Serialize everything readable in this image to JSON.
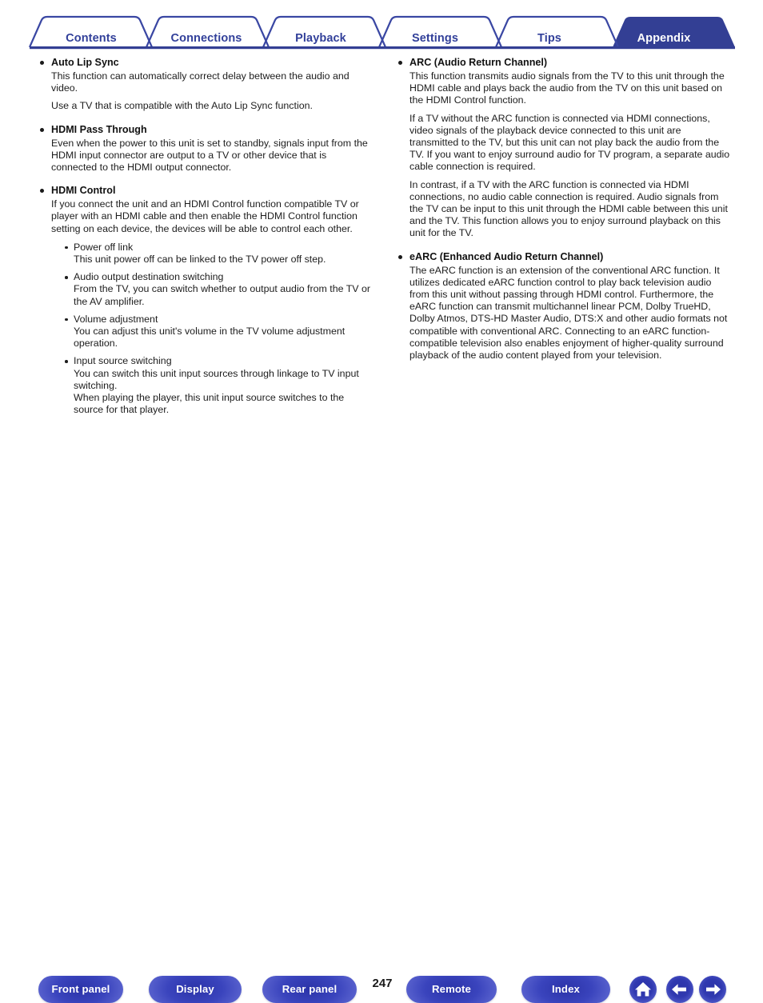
{
  "colors": {
    "brand_blue": "#32409a",
    "active_tab_fill": "#333f94",
    "text": "#1a1a1a",
    "pill_blue": "#3039b0"
  },
  "tabs": [
    {
      "label": "Contents",
      "active": false
    },
    {
      "label": "Connections",
      "active": false
    },
    {
      "label": "Playback",
      "active": false
    },
    {
      "label": "Settings",
      "active": false
    },
    {
      "label": "Tips",
      "active": false
    },
    {
      "label": "Appendix",
      "active": true
    }
  ],
  "columns": {
    "left": [
      {
        "heading": "Auto Lip Sync",
        "paragraphs": [
          "This function can automatically correct delay between the audio and video.",
          "Use a TV that is compatible with the Auto Lip Sync function."
        ],
        "subitems": []
      },
      {
        "heading": "HDMI Pass Through",
        "paragraphs": [
          "Even when the power to this unit is set to standby, signals input from the HDMI input connector are output to a TV or other device that is connected to the HDMI output connector."
        ],
        "subitems": []
      },
      {
        "heading": "HDMI Control",
        "paragraphs": [
          "If you connect the unit and an HDMI Control function compatible TV or player with an HDMI cable and then enable the HDMI Control function setting on each device, the devices will be able to control each other."
        ],
        "subitems": [
          {
            "title": "Power off link",
            "body": "This unit power off can be linked to the TV power off step."
          },
          {
            "title": "Audio output destination switching",
            "body": "From the TV, you can switch whether to output audio from the TV or the AV amplifier."
          },
          {
            "title": "Volume adjustment",
            "body": "You can adjust this unit's volume in the TV volume adjustment operation."
          },
          {
            "title": "Input source switching",
            "body": "You can switch this unit input sources through linkage to TV input switching.\nWhen playing the player, this unit input source switches to the source for that player."
          }
        ]
      }
    ],
    "right": [
      {
        "heading": "ARC (Audio Return Channel)",
        "paragraphs": [
          "This function transmits audio signals from the TV to this unit through the HDMI cable and plays back the audio from the TV on this unit based on the HDMI Control function.",
          "If a TV without the ARC function is connected via HDMI connections, video signals of the playback device connected to this unit are transmitted to the TV, but this unit can not play back the audio from the TV. If you want to enjoy surround audio for TV program, a separate audio cable connection is required.",
          "In contrast, if a TV with the ARC function is connected via HDMI connections, no audio cable connection is required. Audio signals from the TV can be input to this unit through the HDMI cable between this unit and the TV. This function allows you to enjoy surround playback on this unit for the TV."
        ],
        "subitems": []
      },
      {
        "heading": "eARC (Enhanced Audio Return Channel)",
        "paragraphs": [
          "The eARC function is an extension of the conventional ARC function. It utilizes dedicated eARC function control to play back television audio from this unit without passing through HDMI control. Furthermore, the eARC function can transmit multichannel linear PCM, Dolby TrueHD, Dolby Atmos, DTS-HD Master Audio, DTS:X and other audio formats not compatible with conventional ARC. Connecting to an eARC function-compatible television also enables enjoyment of higher-quality surround playback of the audio content played from your television."
        ],
        "subitems": []
      }
    ]
  },
  "footer": {
    "buttons": [
      {
        "label": "Front panel"
      },
      {
        "label": "Display"
      },
      {
        "label": "Rear panel"
      },
      {
        "label": "Remote"
      },
      {
        "label": "Index"
      }
    ],
    "page_number": "247",
    "icons": [
      {
        "name": "home-icon"
      },
      {
        "name": "arrow-left-icon"
      },
      {
        "name": "arrow-right-icon"
      }
    ]
  }
}
